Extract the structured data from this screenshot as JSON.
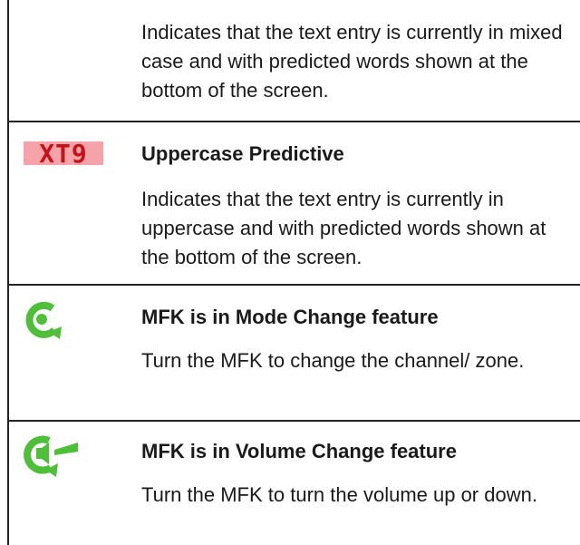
{
  "rows": [
    {
      "title": "",
      "description": "Indicates that the text entry is currently in mixed case and with predicted words shown at the bottom of the screen.",
      "icon": ""
    },
    {
      "title": "Uppercase Predictive",
      "description": "Indicates that the text entry is currently in uppercase and with predicted words shown at the bottom of the screen.",
      "icon": "xt9-uppercase-icon",
      "icon_label": "XT9"
    },
    {
      "title": "MFK is in Mode Change feature",
      "description": "Turn the MFK to change the channel/ zone.",
      "icon": "mode-change-icon"
    },
    {
      "title": "MFK is in Volume Change feature",
      "description": "Turn the MFK to turn the volume up or down.",
      "icon": "volume-change-icon"
    }
  ],
  "colors": {
    "xt9_fill": "#f4a3a8",
    "xt9_text": "#c4121a",
    "icon_green": "#4fbf3a",
    "border": "#222222"
  }
}
